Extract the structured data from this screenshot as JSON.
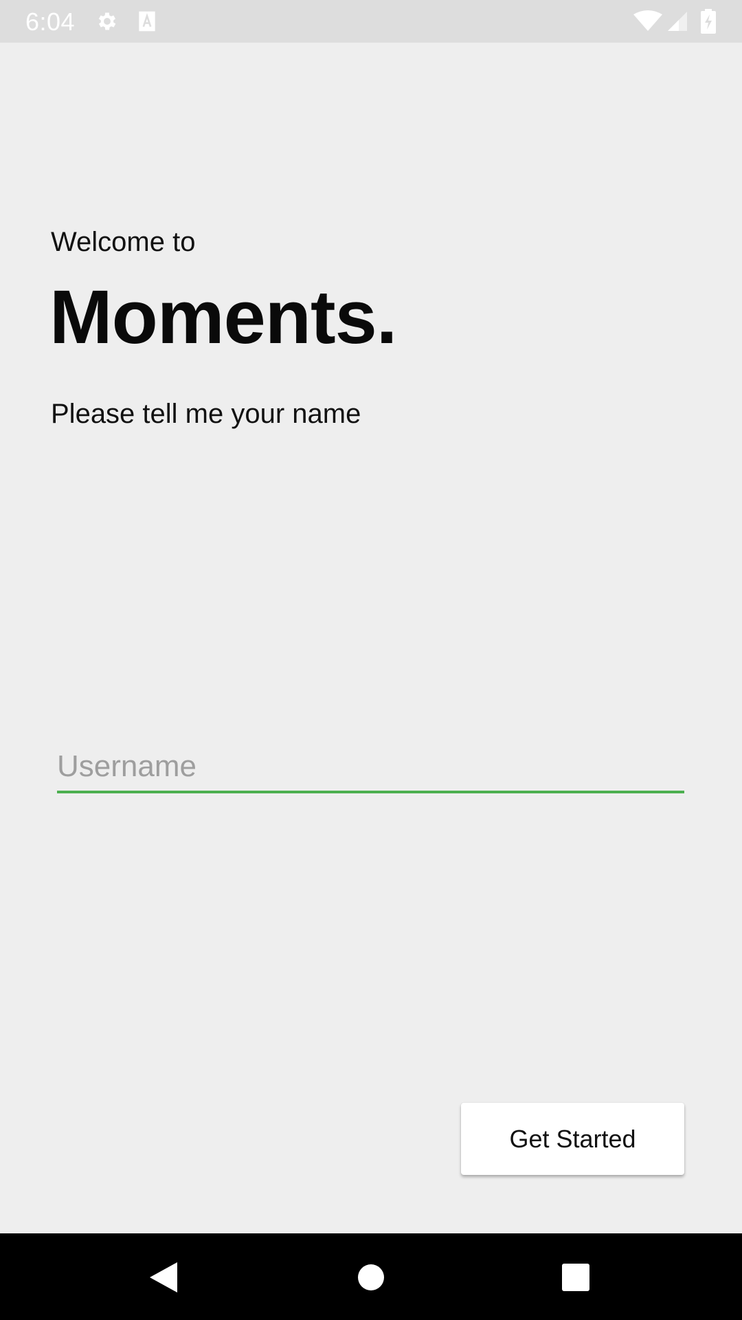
{
  "status_bar": {
    "time": "6:04",
    "icons": [
      "gear-icon",
      "text-a-icon",
      "wifi-icon",
      "signal-icon",
      "battery-charging-icon"
    ]
  },
  "main": {
    "welcome_text": "Welcome to",
    "app_title": "Moments.",
    "prompt_text": "Please tell me your name",
    "username": {
      "value": "",
      "placeholder": "Username"
    },
    "get_started_label": "Get Started"
  },
  "nav_bar": {
    "icons": [
      "back-icon",
      "home-icon",
      "recents-icon"
    ]
  },
  "colors": {
    "background": "#eeeeee",
    "status_bar": "#dddddd",
    "accent_underline": "#4caf50",
    "nav_bar": "#000000"
  }
}
